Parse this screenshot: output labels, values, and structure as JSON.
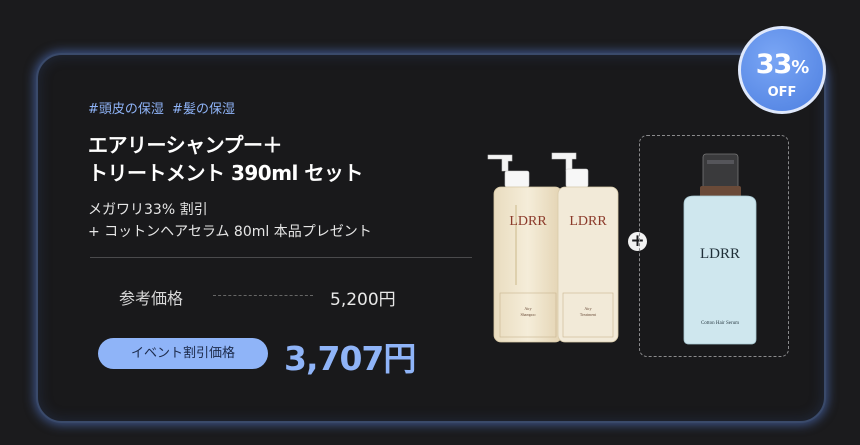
{
  "badge": {
    "percent": "33",
    "percent_sign": "%",
    "off_label": "OFF"
  },
  "tags": [
    "#頭皮の保湿",
    "#髪の保湿"
  ],
  "title_line1": "エアリーシャンプー＋",
  "title_line2": "トリートメント 390ml セット",
  "desc_line1": "メガワリ33% 割引",
  "desc_line2": "+ コットンヘアセラム 80ml 本品プレゼント",
  "reference": {
    "label": "参考価格",
    "price": "5,200円"
  },
  "event": {
    "label": "イベント割引価格",
    "price": "3,707円"
  },
  "products": {
    "shampoo": {
      "brand": "LDRR",
      "name_line1": "Airy",
      "name_line2": "Shampoo"
    },
    "treatment": {
      "brand": "LDRR",
      "name_line1": "Airy",
      "name_line2": "Treatment"
    },
    "serum": {
      "brand": "LDRR",
      "name": "Cotton Hair Serum"
    }
  },
  "plus_symbol": "+",
  "colors": {
    "accent": "#8fb4f8",
    "badge": "#5b8ae6",
    "background": "#1b1b1d"
  }
}
